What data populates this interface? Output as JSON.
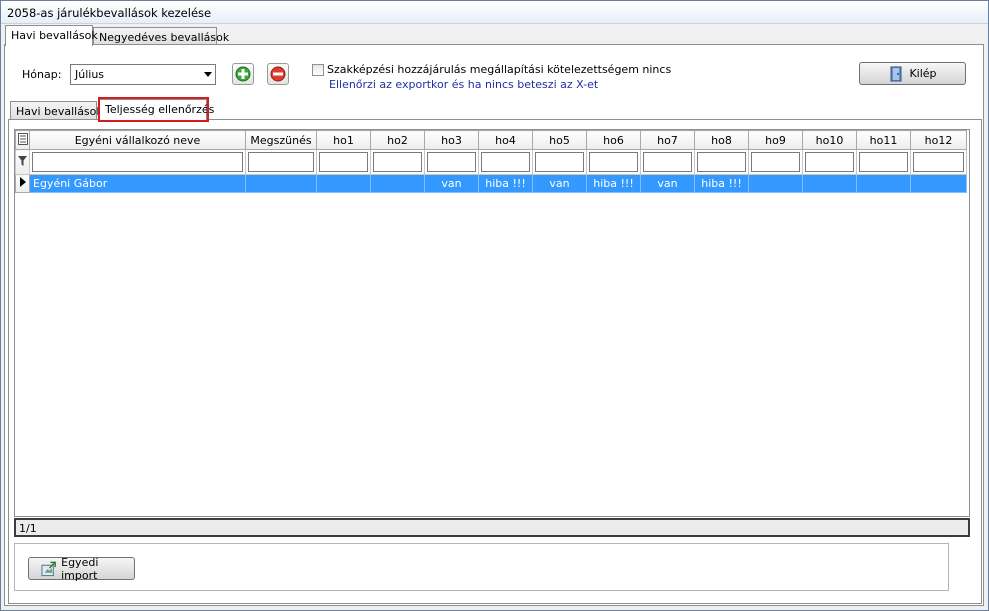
{
  "window": {
    "title": "2058-as járulékbevallások kezelése"
  },
  "outer_tabs": [
    {
      "label": "Havi bevallások",
      "active": true
    },
    {
      "label": "Negyedéves bevallások",
      "active": false
    }
  ],
  "toolbar": {
    "month_label": "Hónap:",
    "month_value": "Július",
    "add_icon": "plus-icon",
    "remove_icon": "minus-icon",
    "checkbox_label": "Szakképzési hozzájárulás megállapítási kötelezettségem nincs",
    "checkbox_checked": false,
    "checkbox_hint": "Ellenőrzi az exportkor és ha nincs beteszi az X-et",
    "exit_label": "Kilép",
    "exit_icon": "door-exit-icon"
  },
  "inner_tabs": [
    {
      "label": "Havi bevallások",
      "active": false
    },
    {
      "label": "Teljesség ellenőrzés",
      "active": true
    }
  ],
  "grid": {
    "columns": [
      "Egyéni vállalkozó neve",
      "Megszünés",
      "ho1",
      "ho2",
      "ho3",
      "ho4",
      "ho5",
      "ho6",
      "ho7",
      "ho8",
      "ho9",
      "ho10",
      "ho11",
      "ho12"
    ],
    "rows": [
      [
        "Egyéni Gábor",
        "",
        "",
        "",
        "van",
        "hiba !!!",
        "van",
        "hiba !!!",
        "van",
        "hiba !!!",
        "",
        "",
        "",
        ""
      ]
    ],
    "status": "1/1"
  },
  "bottom": {
    "import_label": "Egyedi import",
    "import_icon": "import-icon"
  },
  "colors": {
    "selection": "#3399ff",
    "highlight_border": "#d81b1b",
    "hint_text": "#1f2fa6"
  }
}
